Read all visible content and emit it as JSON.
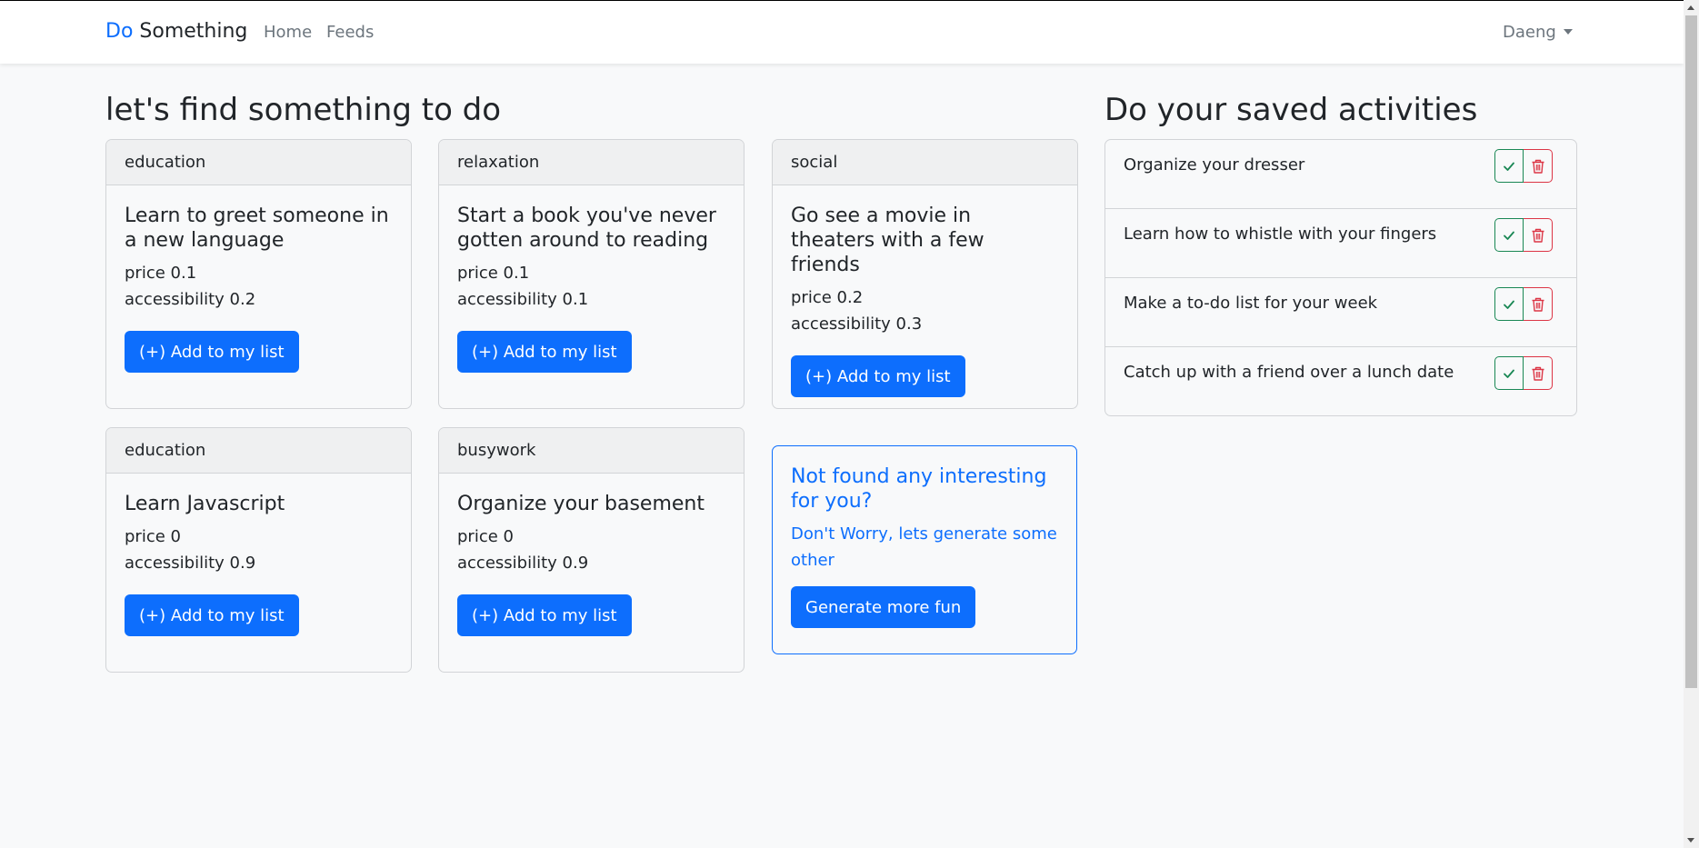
{
  "nav": {
    "brand_do": "Do",
    "brand_something": "Something",
    "links": [
      "Home",
      "Feeds"
    ],
    "user": "Daeng"
  },
  "main": {
    "left_heading": "let's find something to do",
    "right_heading": "Do your saved activities"
  },
  "activities": [
    {
      "type": "education",
      "title": "Learn to greet someone in a new language",
      "price": "price 0.1",
      "accessibility": "accessibility 0.2",
      "button": "(+) Add to my list"
    },
    {
      "type": "relaxation",
      "title": "Start a book you've never gotten around to reading",
      "price": "price 0.1",
      "accessibility": "accessibility 0.1",
      "button": "(+) Add to my list"
    },
    {
      "type": "social",
      "title": "Go see a movie in theaters with a few friends",
      "price": "price 0.2",
      "accessibility": "accessibility 0.3",
      "button": "(+) Add to my list"
    },
    {
      "type": "education",
      "title": "Learn Javascript",
      "price": "price 0",
      "accessibility": "accessibility 0.9",
      "button": "(+) Add to my list"
    },
    {
      "type": "busywork",
      "title": "Organize your basement",
      "price": "price 0",
      "accessibility": "accessibility 0.9",
      "button": "(+) Add to my list"
    }
  ],
  "cta": {
    "title": "Not found any interesting for you?",
    "text": "Don't Worry, lets generate some other",
    "button": "Generate more fun"
  },
  "saved": [
    "Organize your dresser",
    "Learn how to whistle with your fingers",
    "Make a to-do list for your week",
    "Catch up with a friend over a lunch date"
  ],
  "icons": {
    "check": "check-icon",
    "delete": "trash-icon",
    "caret": "caret-down-icon"
  },
  "colors": {
    "primary": "#0d6efd",
    "success": "#198754",
    "danger": "#dc3545",
    "background": "#f8f9fa"
  }
}
